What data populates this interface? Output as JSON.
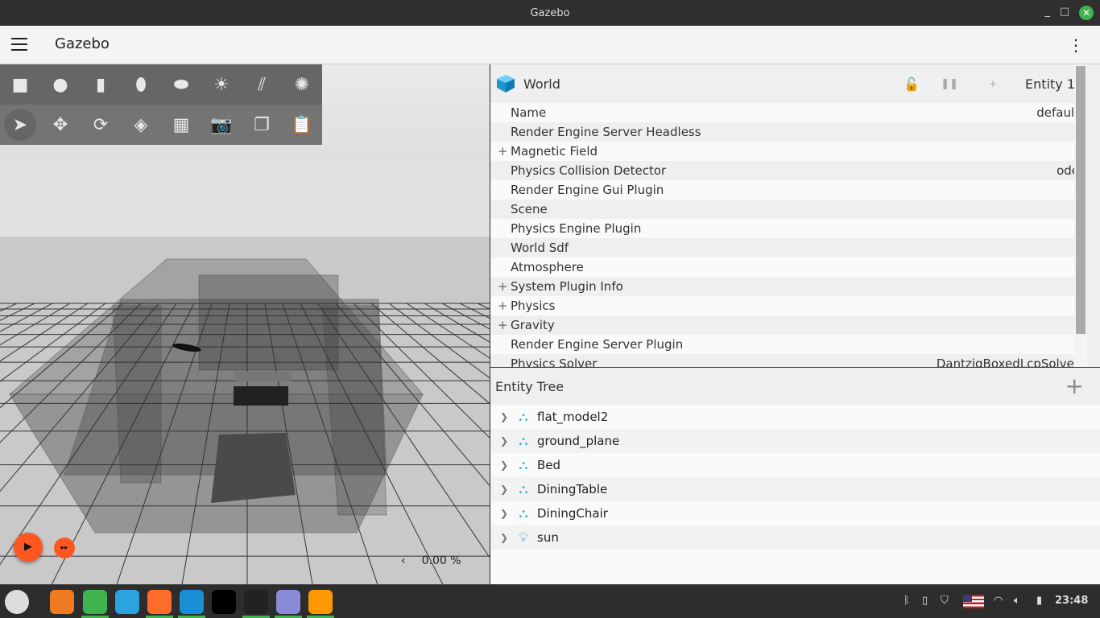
{
  "window": {
    "title": "Gazebo",
    "minimize": "_",
    "maximize": "□",
    "close": "✕"
  },
  "appbar": {
    "title": "Gazebo",
    "menu_icon": "hamburger-icon",
    "more_icon": "⋮"
  },
  "toolbar": {
    "shapes": [
      {
        "name": "box",
        "glyph": "■"
      },
      {
        "name": "sphere",
        "glyph": "●"
      },
      {
        "name": "cylinder",
        "glyph": "▮"
      },
      {
        "name": "capsule",
        "glyph": "⬮"
      },
      {
        "name": "ellipsoid",
        "glyph": "⬬"
      },
      {
        "name": "point-light",
        "glyph": "☀"
      },
      {
        "name": "directional-light",
        "glyph": "⫽"
      },
      {
        "name": "spot-light",
        "glyph": "✺"
      }
    ],
    "transform": [
      {
        "name": "select",
        "glyph": "➤"
      },
      {
        "name": "translate",
        "glyph": "✥"
      },
      {
        "name": "rotate",
        "glyph": "⟳"
      },
      {
        "name": "snap",
        "glyph": "◈"
      },
      {
        "name": "grid",
        "glyph": "▦"
      },
      {
        "name": "screenshot",
        "glyph": "📷"
      },
      {
        "name": "copy",
        "glyph": "❐"
      },
      {
        "name": "paste",
        "glyph": "📋"
      }
    ]
  },
  "playback": {
    "play": "▶",
    "fast_forward": "▸▸",
    "rtf_arrow": "‹",
    "rtf": "0.00 %",
    "accent": "#ff5722"
  },
  "component_inspector": {
    "title": "World",
    "entity": "Entity 1",
    "lock_icon": "🔓",
    "pause_icon": "❚❚",
    "add_icon": "+",
    "rows": [
      {
        "label": "Name",
        "value": "default",
        "expand": ""
      },
      {
        "label": "Render Engine Server Headless",
        "value": "",
        "expand": ""
      },
      {
        "label": "Magnetic Field",
        "value": "",
        "expand": "+"
      },
      {
        "label": "Physics Collision Detector",
        "value": "ode",
        "expand": ""
      },
      {
        "label": "Render Engine Gui Plugin",
        "value": "",
        "expand": ""
      },
      {
        "label": "Scene",
        "value": "",
        "expand": ""
      },
      {
        "label": "Physics Engine Plugin",
        "value": "",
        "expand": ""
      },
      {
        "label": "World Sdf",
        "value": "",
        "expand": ""
      },
      {
        "label": "Atmosphere",
        "value": "",
        "expand": ""
      },
      {
        "label": "System Plugin Info",
        "value": "",
        "expand": "+"
      },
      {
        "label": "Physics",
        "value": "",
        "expand": "+"
      },
      {
        "label": "Gravity",
        "value": "",
        "expand": "+"
      },
      {
        "label": "Render Engine Server Plugin",
        "value": "",
        "expand": ""
      },
      {
        "label": "Physics Solver",
        "value": "DantzigBoxedLcpSolver",
        "expand": ""
      }
    ]
  },
  "entity_tree": {
    "title": "Entity Tree",
    "add": "+",
    "items": [
      {
        "name": "flat_model2",
        "icon": "model-icon"
      },
      {
        "name": "ground_plane",
        "icon": "model-icon"
      },
      {
        "name": "Bed",
        "icon": "model-icon"
      },
      {
        "name": "DiningTable",
        "icon": "model-icon"
      },
      {
        "name": "DiningChair",
        "icon": "model-icon"
      },
      {
        "name": "sun",
        "icon": "light-icon"
      }
    ]
  },
  "taskbar": {
    "clock": "23:48",
    "apps": [
      "mint-menu",
      "anaconda",
      "files",
      "telegram",
      "firefox",
      "edge",
      "app",
      "terminal",
      "text-editor",
      "gazebo"
    ]
  }
}
